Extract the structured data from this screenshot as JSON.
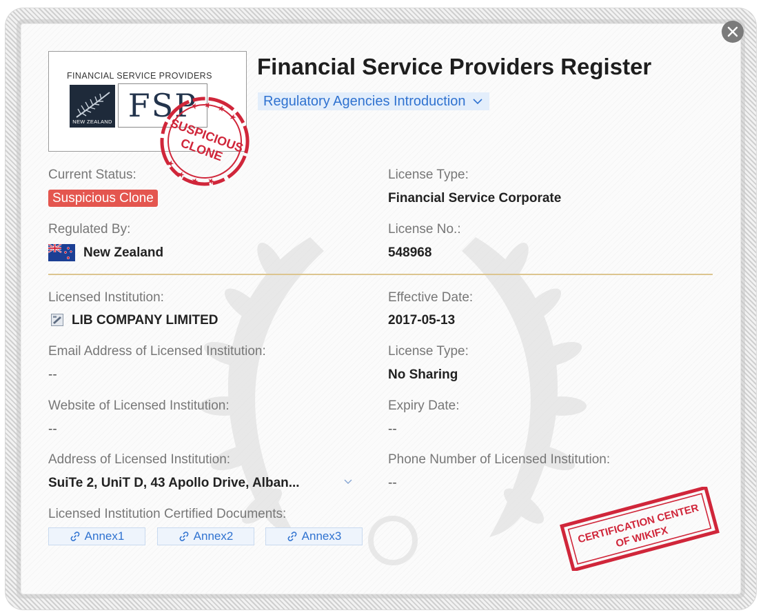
{
  "header": {
    "title": "Financial Service Providers Register",
    "agency_link": "Regulatory Agencies Introduction"
  },
  "logo": {
    "top_text": "FINANCIAL SERVICE PROVIDERS",
    "nz_text": "NEW ZEALAND",
    "fsp_text": "FSP",
    "stamp_text_1": "SUSPICIOUS",
    "stamp_text_2": "CLONE"
  },
  "status": {
    "label": "Current Status:",
    "value": "Suspicious Clone"
  },
  "license_type_1": {
    "label": "License Type:",
    "value": "Financial Service Corporate"
  },
  "regulated_by": {
    "label": "Regulated By:",
    "value": "New Zealand"
  },
  "license_no": {
    "label": "License No.:",
    "value": "548968"
  },
  "institution": {
    "label": "Licensed Institution:",
    "value": "LIB COMPANY LIMITED"
  },
  "effective_date": {
    "label": "Effective Date:",
    "value": "2017-05-13"
  },
  "email": {
    "label": "Email Address of Licensed Institution:",
    "value": "--"
  },
  "license_type_2": {
    "label": "License Type:",
    "value": "No Sharing"
  },
  "website": {
    "label": "Website of Licensed Institution:",
    "value": "--"
  },
  "expiry_date": {
    "label": "Expiry Date:",
    "value": "--"
  },
  "address": {
    "label": "Address of Licensed Institution:",
    "value": "SuiTe 2, UniT D, 43 Apollo Drive, Alban..."
  },
  "phone": {
    "label": "Phone Number of Licensed Institution:",
    "value": "--"
  },
  "documents": {
    "label": "Licensed Institution Certified Documents:",
    "annexes": [
      "Annex1",
      "Annex2",
      "Annex3"
    ]
  },
  "certification_stamp": {
    "line1": "CERTIFICATION CENTER",
    "line2": "OF WIKIFX"
  },
  "colors": {
    "accent_blue": "#2f72d0",
    "status_red": "#e4564f",
    "divider_gold": "#dcc58f",
    "stamp_red": "#d0263a"
  },
  "icons": [
    "close-icon",
    "chevron-down-icon",
    "nz-flag-icon",
    "institution-icon",
    "link-icon"
  ]
}
